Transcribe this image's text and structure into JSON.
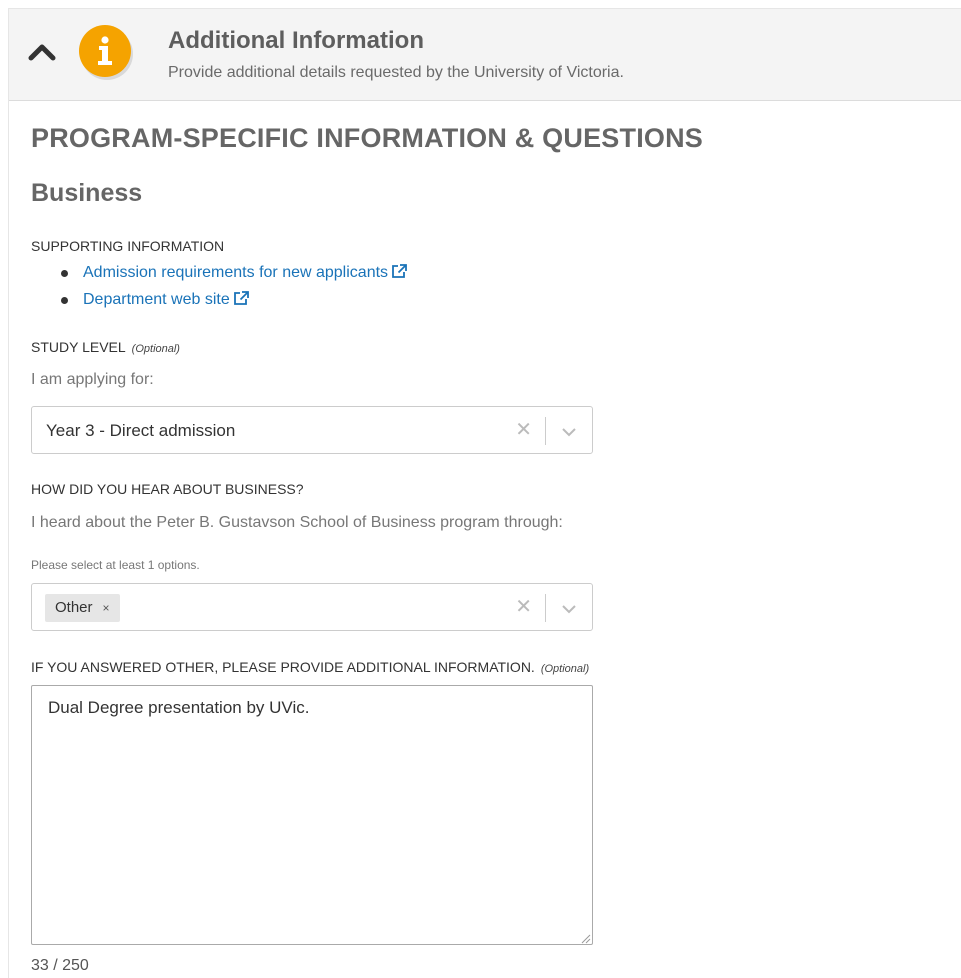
{
  "header": {
    "title": "Additional Information",
    "subtitle": "Provide additional details requested by the University of Victoria.",
    "info_icon": "info-icon",
    "collapse_icon": "chevron-up-icon",
    "badge_color": "#f5a300"
  },
  "section": {
    "title": "PROGRAM-SPECIFIC INFORMATION & QUESTIONS",
    "program": "Business"
  },
  "supporting": {
    "label": "SUPPORTING INFORMATION",
    "links": [
      {
        "text": "Admission requirements for new applicants",
        "icon": "external-link-icon"
      },
      {
        "text": "Department web site",
        "icon": "external-link-icon"
      }
    ],
    "link_color": "#1a73b8"
  },
  "study_level": {
    "label": "STUDY LEVEL",
    "optional": "(Optional)",
    "help": "I am applying for:",
    "value": "Year 3 - Direct admission",
    "clear_icon": "clear-icon",
    "dropdown_icon": "chevron-down-icon"
  },
  "hear_about": {
    "label": "HOW DID YOU HEAR ABOUT BUSINESS?",
    "help": "I heard about the Peter B. Gustavson School of Business program through:",
    "note": "Please select at least 1 options.",
    "selected": [
      {
        "label": "Other",
        "remove": "×"
      }
    ],
    "clear_icon": "clear-icon",
    "dropdown_icon": "chevron-down-icon"
  },
  "other_info": {
    "label": "IF YOU ANSWERED OTHER, PLEASE PROVIDE ADDITIONAL INFORMATION.",
    "optional": "(Optional)",
    "value": "Dual Degree presentation by UVic.",
    "counter": "33 / 250"
  }
}
